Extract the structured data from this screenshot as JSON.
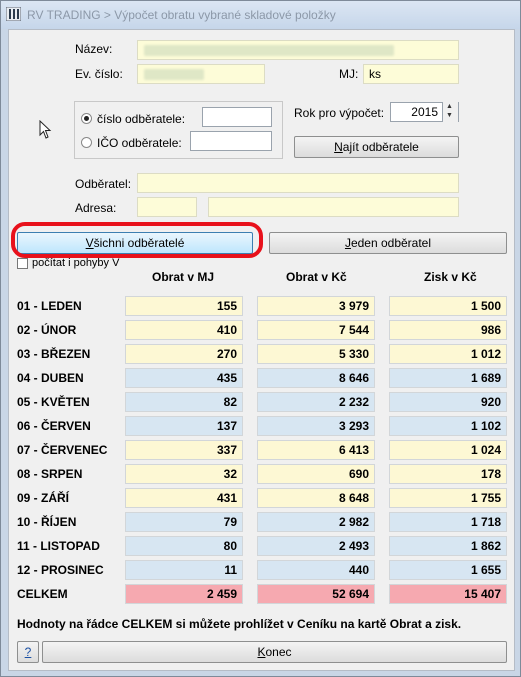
{
  "window": {
    "title": "RV TRADING > Výpočet obratu vybrané skladové položky"
  },
  "form": {
    "nazev_label": "Název:",
    "evcislo_label": "Ev. číslo:",
    "mj_label": "MJ:",
    "mj_value": "ks",
    "radio_cislo_label": "číslo odběratele:",
    "radio_ico_label": "IČO odběratele:",
    "rok_label": "Rok pro výpočet:",
    "rok_value": "2015",
    "najit_prefix": "N",
    "najit_rest": "ajít odběratele",
    "odberatel_label": "Odběratel:",
    "adresa_label": "Adresa:"
  },
  "buttons": {
    "vsichni_prefix": "V",
    "vsichni_rest": "šichni odběratelé",
    "jeden_prefix": "J",
    "jeden_rest": "eden odběratel",
    "help": "?",
    "konec_prefix": "K",
    "konec_rest": "onec"
  },
  "checkbox": {
    "label": "počítat i pohyby V"
  },
  "table": {
    "headers": [
      "Obrat v MJ",
      "Obrat v Kč",
      "Zisk v Kč"
    ],
    "rows": [
      {
        "label": "01 - LEDEN",
        "mj": "155",
        "kc": "3 979",
        "zisk": "1 500",
        "tone": "y"
      },
      {
        "label": "02 - ÚNOR",
        "mj": "410",
        "kc": "7 544",
        "zisk": "986",
        "tone": "y"
      },
      {
        "label": "03 - BŘEZEN",
        "mj": "270",
        "kc": "5 330",
        "zisk": "1 012",
        "tone": "y"
      },
      {
        "label": "04 - DUBEN",
        "mj": "435",
        "kc": "8 646",
        "zisk": "1 689",
        "tone": "b"
      },
      {
        "label": "05 - KVĚTEN",
        "mj": "82",
        "kc": "2 232",
        "zisk": "920",
        "tone": "b"
      },
      {
        "label": "06 - ČERVEN",
        "mj": "137",
        "kc": "3 293",
        "zisk": "1 102",
        "tone": "b"
      },
      {
        "label": "07 - ČERVENEC",
        "mj": "337",
        "kc": "6 413",
        "zisk": "1 024",
        "tone": "y"
      },
      {
        "label": "08 - SRPEN",
        "mj": "32",
        "kc": "690",
        "zisk": "178",
        "tone": "y"
      },
      {
        "label": "09 - ZÁŘÍ",
        "mj": "431",
        "kc": "8 648",
        "zisk": "1 755",
        "tone": "y"
      },
      {
        "label": "10 - ŘÍJEN",
        "mj": "79",
        "kc": "2 982",
        "zisk": "1 718",
        "tone": "b"
      },
      {
        "label": "11 - LISTOPAD",
        "mj": "80",
        "kc": "2 493",
        "zisk": "1 862",
        "tone": "b"
      },
      {
        "label": "12 - PROSINEC",
        "mj": "11",
        "kc": "440",
        "zisk": "1 655",
        "tone": "b"
      }
    ],
    "total": {
      "label": "CELKEM",
      "mj": "2 459",
      "kc": "52 694",
      "zisk": "15 407"
    }
  },
  "note": "Hodnoty na řádce CELKEM si můžete prohlížet v Ceníku na kartě Obrat a zisk.",
  "colors": {
    "yellow_cell": "#fdf8d4",
    "blue_cell": "#d7e6f2",
    "total_cell": "#f6a9b0",
    "highlight": "#e8111b"
  }
}
